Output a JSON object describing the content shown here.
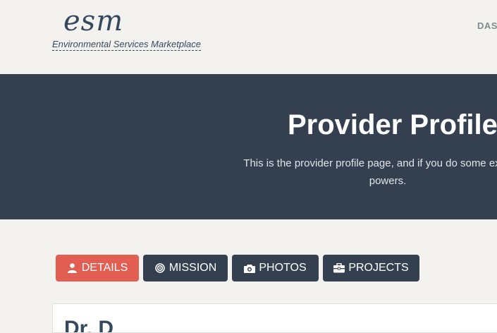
{
  "header": {
    "logo_mark": "esm",
    "logo_tagline": "Environmental Services Marketplace",
    "nav_dashboard": "DASI"
  },
  "hero": {
    "title": "Provider Profile",
    "text_line1": "This is the provider profile page, and if you do some exploring",
    "text_line2": "powers."
  },
  "tabs": [
    {
      "label": "DETAILS",
      "icon": "user-icon",
      "active": true
    },
    {
      "label": "MISSION",
      "icon": "target-icon",
      "active": false
    },
    {
      "label": "PHOTOS",
      "icon": "camera-icon",
      "active": false
    },
    {
      "label": "PROJECTS",
      "icon": "briefcase-icon",
      "active": false
    }
  ],
  "card": {
    "title": "Dr. D"
  },
  "colors": {
    "accent": "#e25d52",
    "dark": "#34404f",
    "background": "#f4f2ee",
    "text": "#34495e"
  }
}
